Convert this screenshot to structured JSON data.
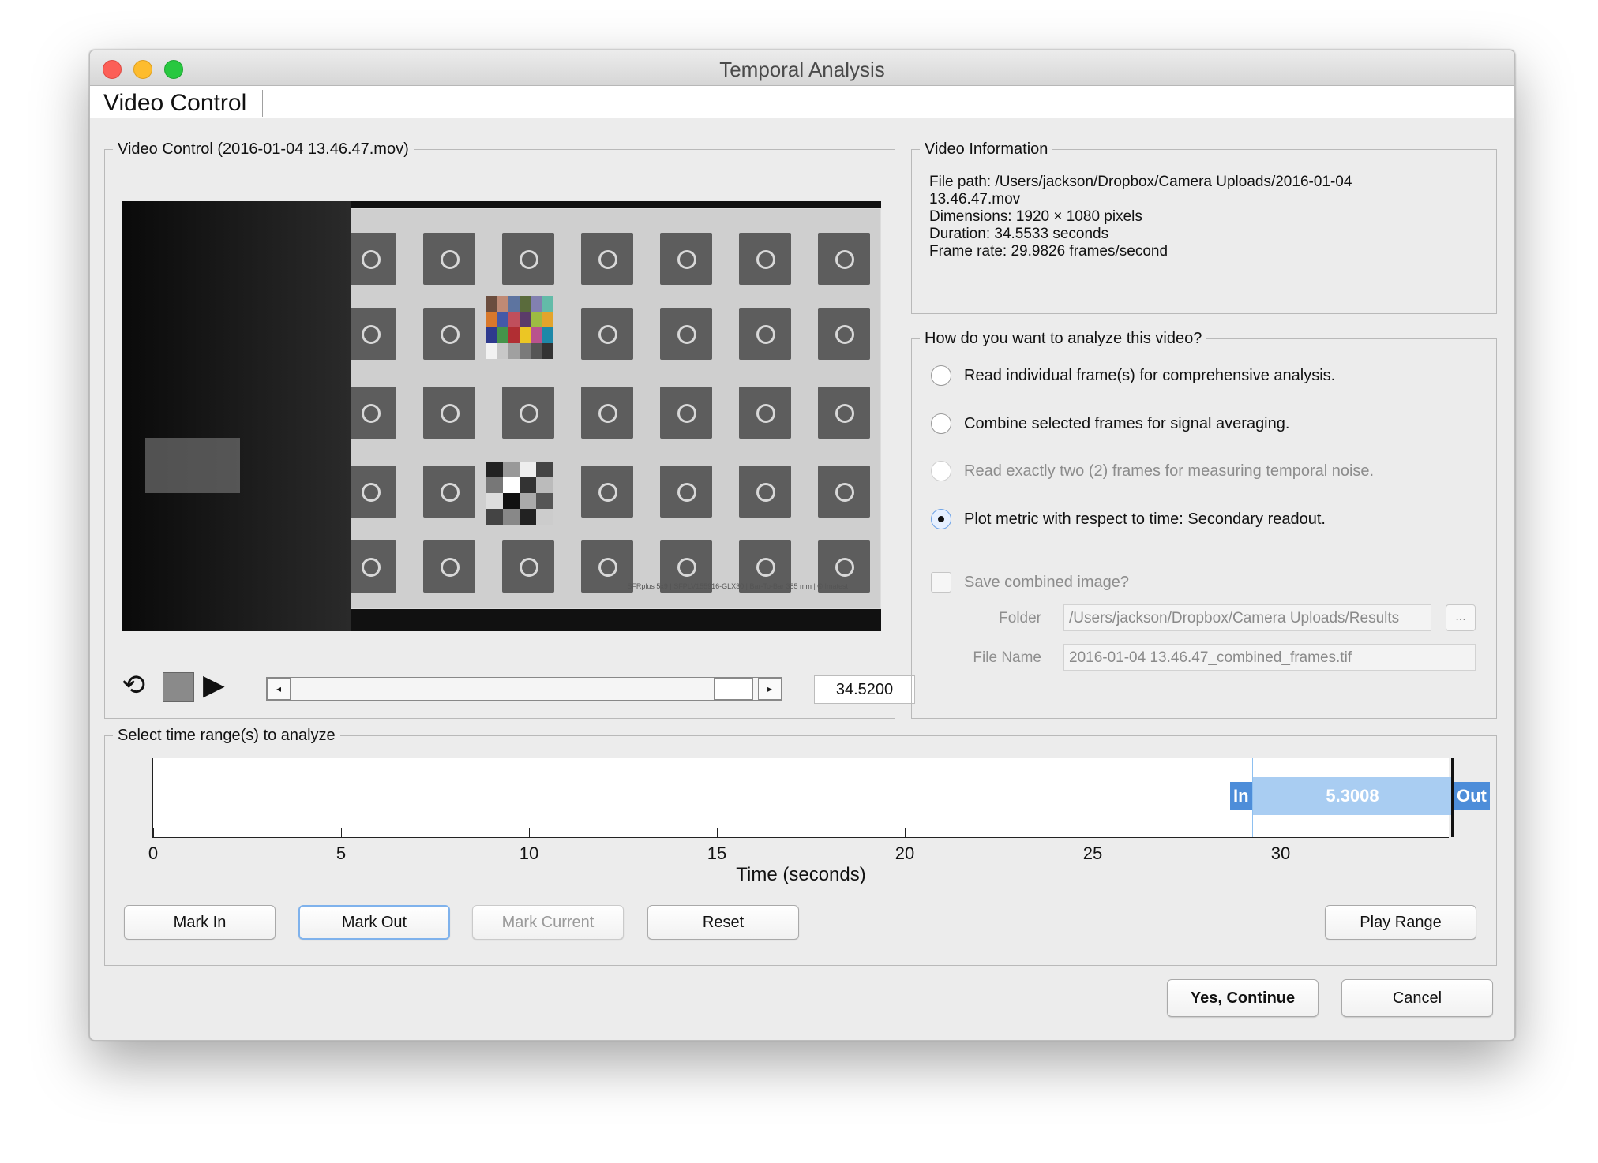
{
  "window": {
    "title": "Temporal Analysis"
  },
  "tab": {
    "label": "Video Control"
  },
  "video_panel": {
    "title": "Video Control (2016-01-04 13.46.47.mov)",
    "frame_footer": "SFRplus 5x9 | SFPLV155916-GLX30 | Bar-To-Bar 385 mm | © Imatest",
    "time_value": "34.5200",
    "icons": {
      "loop": "loop-icon",
      "stop": "stop-icon",
      "play": "play-icon"
    }
  },
  "info_panel": {
    "title": "Video Information",
    "lines": [
      "File path: /Users/jackson/Dropbox/Camera Uploads/2016-01-04",
      "13.46.47.mov",
      "Dimensions: 1920 × 1080 pixels",
      "Duration: 34.5533 seconds",
      "Frame rate: 29.9826 frames/second"
    ]
  },
  "analyze_panel": {
    "title": "How do you want to analyze this video?",
    "options": [
      "Read individual frame(s) for comprehensive analysis.",
      "Combine selected frames for signal averaging.",
      "Read exactly two (2) frames for measuring temporal noise.",
      "Plot metric with respect to time: Secondary readout."
    ],
    "save_checkbox": "Save combined image?",
    "folder_label": "Folder",
    "folder_value": "/Users/jackson/Dropbox/Camera Uploads/Results",
    "browse_label": "...",
    "filename_label": "File Name",
    "filename_value": "2016-01-04 13.46.47_combined_frames.tif"
  },
  "range_panel": {
    "title": "Select time range(s) to analyze",
    "in_label": "In",
    "out_label": "Out",
    "range_value": "5.3008",
    "ticks": [
      "0",
      "5",
      "10",
      "15",
      "20",
      "25",
      "30"
    ],
    "xlabel": "Time (seconds)",
    "buttons": {
      "mark_in": "Mark In",
      "mark_out": "Mark Out",
      "mark_current": "Mark Current",
      "reset": "Reset",
      "play_range": "Play Range"
    }
  },
  "footer": {
    "continue_label": "Yes, Continue",
    "cancel_label": "Cancel"
  },
  "colors": {
    "range_band": "#a9cdf2",
    "range_tag": "#4d8dd9",
    "focus_ring": "#7fb2ec"
  }
}
